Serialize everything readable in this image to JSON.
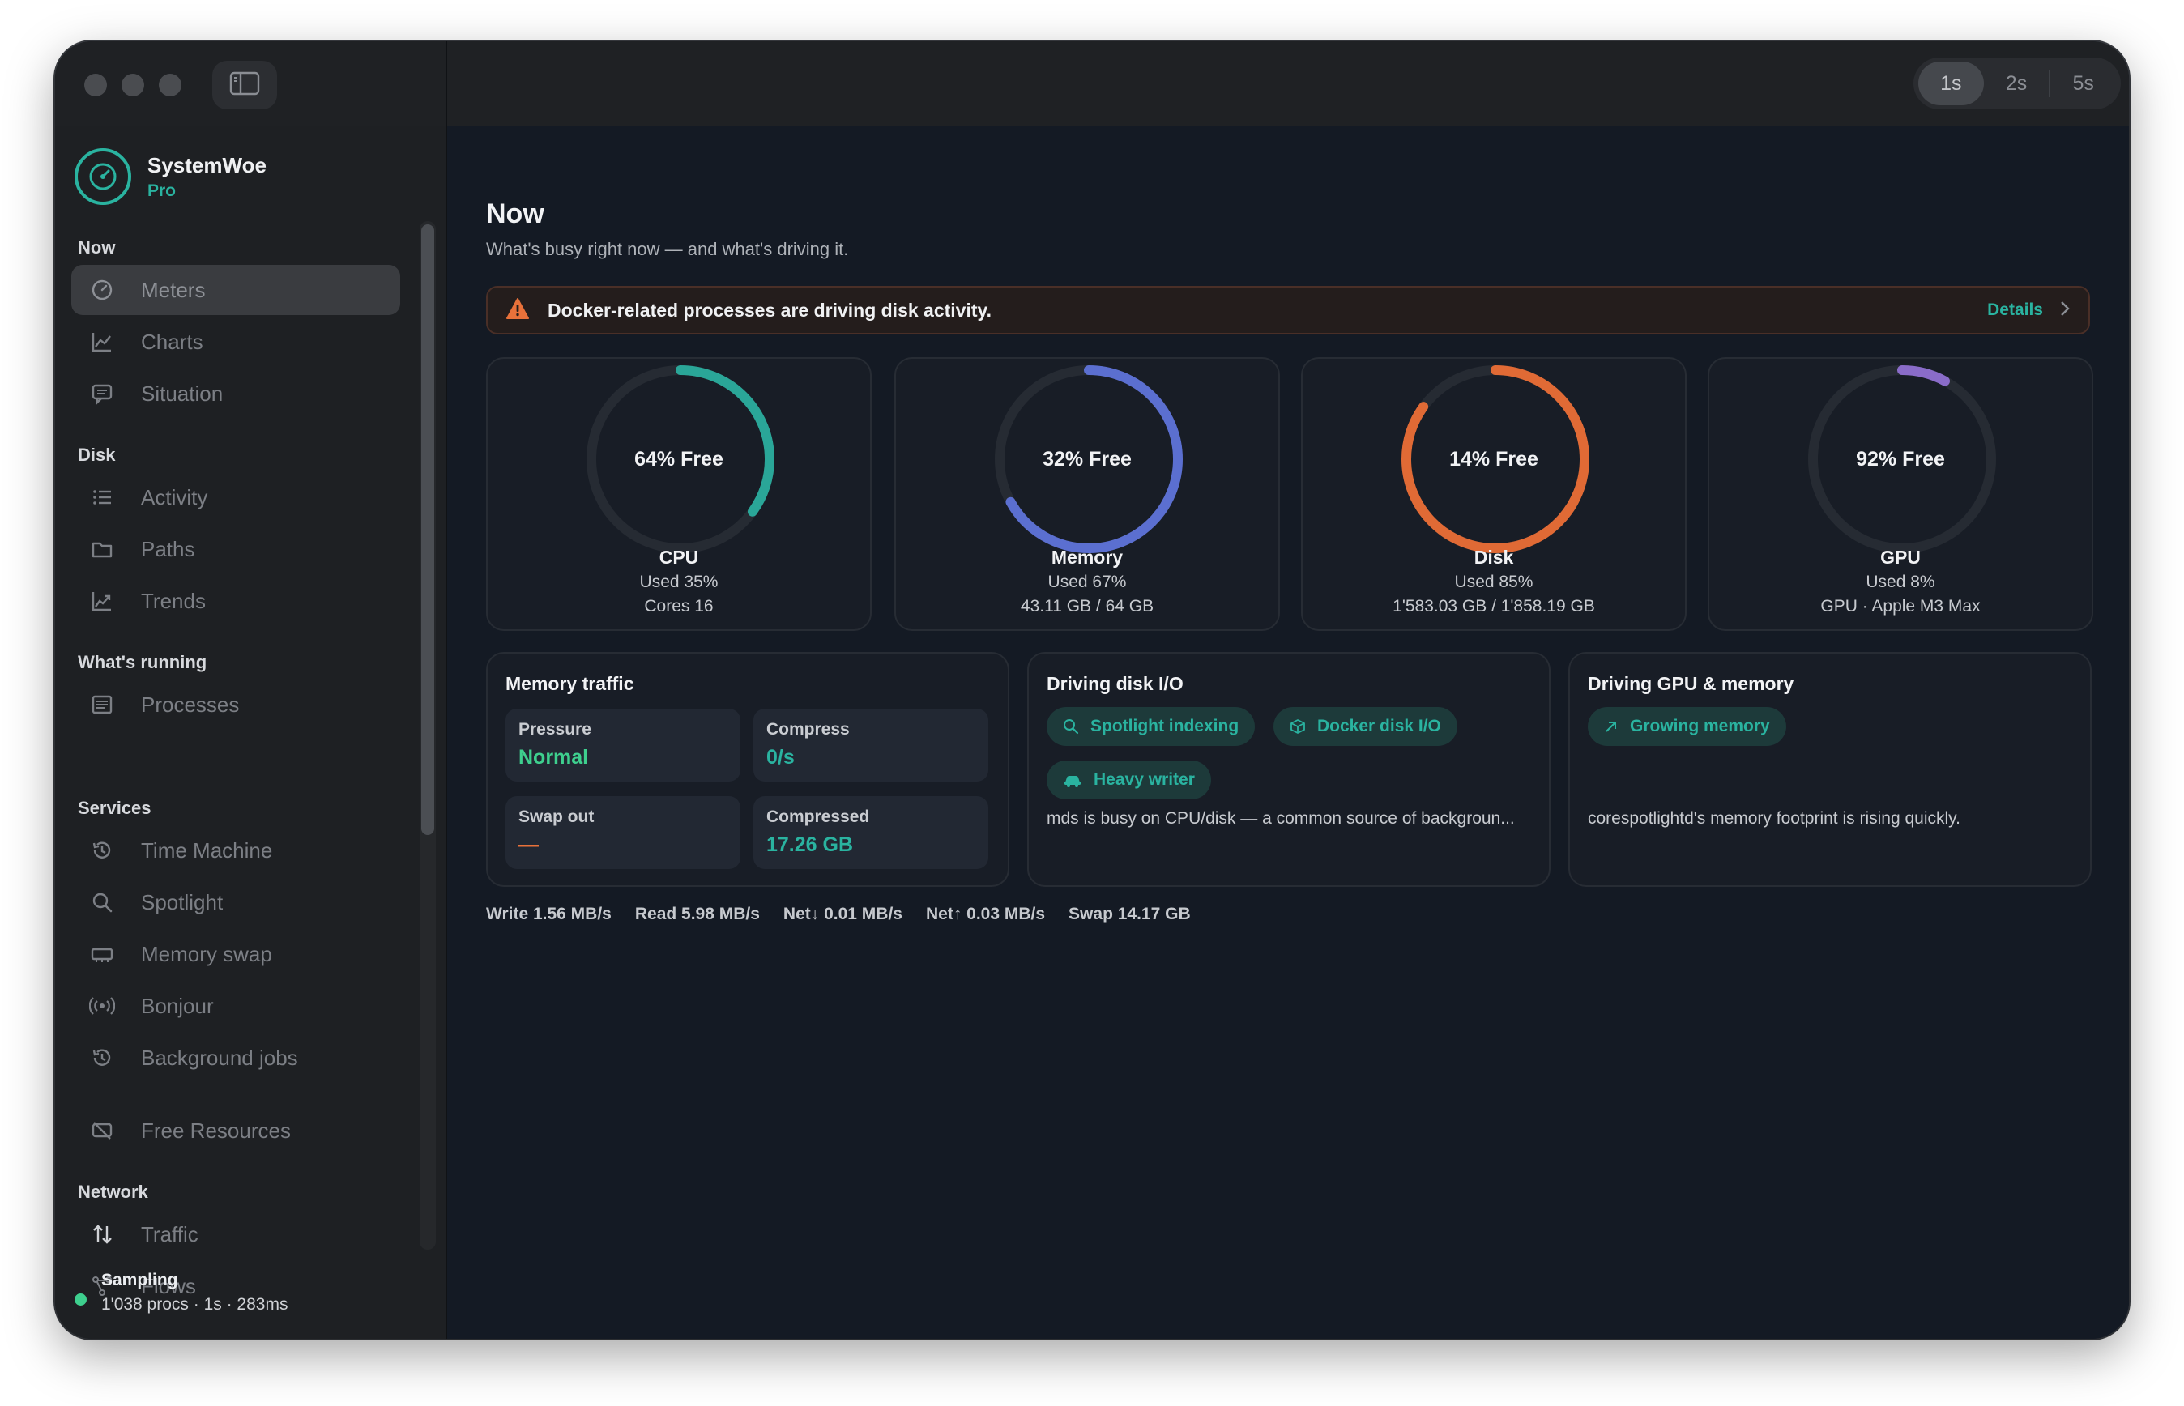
{
  "titlebar": {
    "intervals": [
      "1s",
      "2s",
      "5s"
    ],
    "active_interval": "1s"
  },
  "brand": {
    "name": "SystemWoe",
    "tier": "Pro"
  },
  "sidebar": {
    "sections": {
      "now": "Now",
      "disk": "Disk",
      "running": "What's running",
      "services": "Services",
      "network": "Network"
    },
    "items": {
      "meters": "Meters",
      "charts": "Charts",
      "situation": "Situation",
      "activity": "Activity",
      "paths": "Paths",
      "trends": "Trends",
      "processes": "Processes",
      "time_machine": "Time Machine",
      "spotlight": "Spotlight",
      "memory_swap": "Memory swap",
      "bonjour": "Bonjour",
      "background_jobs": "Background jobs",
      "free_resources": "Free Resources",
      "traffic": "Traffic",
      "flows": "Flows"
    },
    "active_item": "Meters",
    "status": {
      "title": "Sampling",
      "detail": "1'038 procs · 1s · 283ms",
      "color": "#3ecf8e"
    }
  },
  "main": {
    "title": "Now",
    "subtitle": "What's busy right now — and what's driving it.",
    "alert": {
      "text": "Docker-related processes are driving disk activity.",
      "action": "Details"
    },
    "gauges": [
      {
        "label": "64% Free",
        "title": "CPU",
        "line1": "Used 35%",
        "line2": "Cores 16",
        "used_fraction": 0.35,
        "color": "#2aa698"
      },
      {
        "label": "32% Free",
        "title": "Memory",
        "line1": "Used 67%",
        "line2": "43.11 GB / 64 GB",
        "used_fraction": 0.67,
        "color": "#5b6fd0"
      },
      {
        "label": "14% Free",
        "title": "Disk",
        "line1": "Used 85%",
        "line2": "1'583.03 GB / 1'858.19 GB",
        "used_fraction": 0.85,
        "color": "#e06a35"
      },
      {
        "label": "92% Free",
        "title": "GPU",
        "line1": "Used 8%",
        "line2": "GPU · Apple M3 Max",
        "used_fraction": 0.08,
        "color": "#8a6cc9"
      }
    ],
    "memory_traffic": {
      "title": "Memory traffic",
      "pressure": {
        "label": "Pressure",
        "value": "Normal"
      },
      "compress": {
        "label": "Compress",
        "value": "0/s"
      },
      "swap_out": {
        "label": "Swap out",
        "value": "—"
      },
      "compressed": {
        "label": "Compressed",
        "value": "17.26 GB"
      }
    },
    "disk_io": {
      "title": "Driving disk I/O",
      "chips": [
        "Spotlight indexing",
        "Docker disk I/O",
        "Heavy writer"
      ],
      "note": "mds is busy on CPU/disk — a common source of backgroun..."
    },
    "gpu_memory": {
      "title": "Driving GPU & memory",
      "chips": [
        "Growing memory"
      ],
      "note": "corespotlightd's memory footprint is rising quickly."
    },
    "stats": {
      "write": "Write 1.56 MB/s",
      "read": "Read 5.98 MB/s",
      "net_down": "Net↓ 0.01 MB/s",
      "net_up": "Net↑ 0.03 MB/s",
      "swap": "Swap 14.17 GB"
    }
  },
  "colors": {
    "accent": "#2ab3a0",
    "warning": "#e8713a",
    "ok": "#3ecf8e"
  }
}
